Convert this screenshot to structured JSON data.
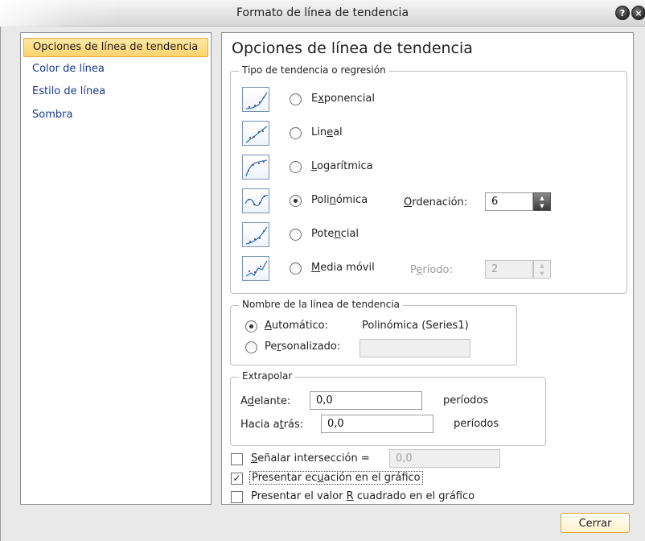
{
  "window": {
    "title": "Formato de línea de tendencia",
    "help_glyph": "?",
    "close_glyph": "×"
  },
  "sidebar": {
    "items": [
      {
        "label": "Opciones de línea de tendencia",
        "selected": true
      },
      {
        "label": "Color de línea",
        "selected": false
      },
      {
        "label": "Estilo de línea",
        "selected": false
      },
      {
        "label": "Sombra",
        "selected": false
      }
    ]
  },
  "main": {
    "heading": "Opciones de línea de tendencia",
    "trend_type": {
      "legend": "Tipo de tendencia o regresión",
      "options": [
        {
          "pre": "E",
          "mnemonic": "x",
          "post": "ponencial",
          "checked": false,
          "icon": "exponential-trend-icon"
        },
        {
          "pre": "Lin",
          "mnemonic": "e",
          "post": "al",
          "checked": false,
          "icon": "linear-trend-icon"
        },
        {
          "pre": "",
          "mnemonic": "L",
          "post": "ogarítmica",
          "checked": false,
          "icon": "logarithmic-trend-icon"
        },
        {
          "pre": "Poli",
          "mnemonic": "n",
          "post": "ómica",
          "checked": true,
          "icon": "polynomial-trend-icon"
        },
        {
          "pre": "Pote",
          "mnemonic": "n",
          "post": "cial",
          "checked": false,
          "icon": "power-trend-icon"
        },
        {
          "pre": "",
          "mnemonic": "M",
          "post": "edia móvil",
          "checked": false,
          "icon": "moving-average-trend-icon"
        }
      ],
      "order": {
        "pre": "",
        "mnemonic": "O",
        "post": "rdenación:",
        "value": "6"
      },
      "period": {
        "pre": "P",
        "mnemonic": "e",
        "post": "ríodo:",
        "value": "2"
      }
    },
    "trendline_name": {
      "legend": "Nombre de la línea de tendencia",
      "automatic": {
        "pre": "",
        "mnemonic": "A",
        "post": "utomático:",
        "checked": true,
        "value": "Polinómica (Series1)"
      },
      "custom": {
        "pre": "Pe",
        "mnemonic": "r",
        "post": "sonalizado:",
        "checked": false,
        "value": ""
      }
    },
    "extrapolate": {
      "legend": "Extrapolar",
      "forward": {
        "pre": "A",
        "mnemonic": "d",
        "post": "elante:",
        "value": "0,0",
        "unit": "períodos"
      },
      "backward": {
        "pre": "Hacia a",
        "mnemonic": "t",
        "post": "rás:",
        "value": "0,0",
        "unit": "períodos"
      }
    },
    "intercept": {
      "pre": "",
      "mnemonic": "S",
      "post": "eñalar intersección =",
      "checked": false,
      "value": "0,0"
    },
    "show_equation": {
      "pre": "Presentar ec",
      "mnemonic": "u",
      "post": "ación en el gráfico",
      "checked": true
    },
    "show_r2": {
      "pre": "Presentar el valor ",
      "mnemonic": "R",
      "post": " cuadrado en el gráfico",
      "checked": false
    },
    "check_glyph": "✓",
    "spin_up": "▲",
    "spin_down": "▼"
  },
  "footer": {
    "close_label": "Cerrar"
  },
  "colors": {
    "selected_item": "#ffd36b",
    "accent_border": "#e2a73d",
    "link_blue": "#1a3a8a"
  }
}
